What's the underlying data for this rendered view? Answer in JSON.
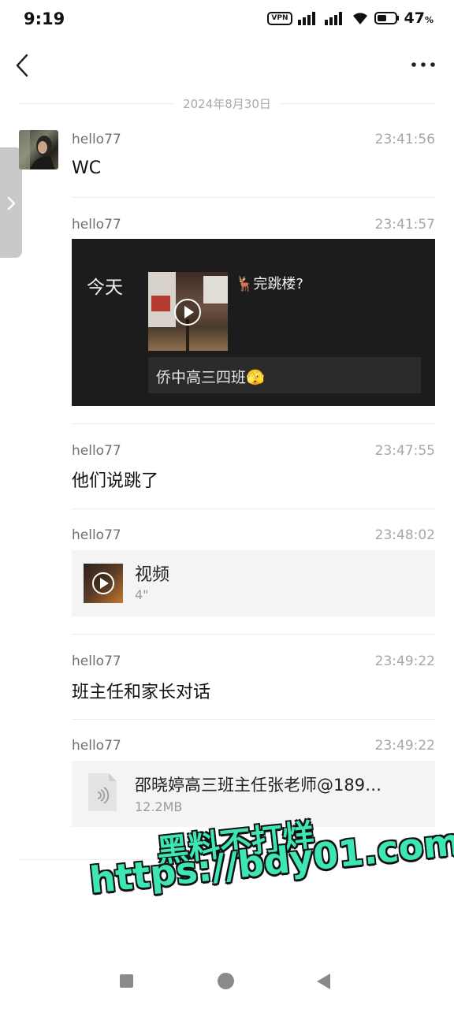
{
  "status_bar": {
    "time": "9:19",
    "vpn_label": "VPN",
    "battery_percent": "47",
    "battery_unit": "%"
  },
  "header": {
    "back_icon": "chevron-left-icon",
    "more_icon": "more-horizontal-icon"
  },
  "date_separator": "2024年8月30日",
  "messages": [
    {
      "sender": "hello77",
      "time": "23:41:56",
      "type": "text",
      "text": "WC"
    },
    {
      "sender": "hello77",
      "time": "23:41:57",
      "type": "shared",
      "card": {
        "heading": "今天",
        "title": "🦌完跳楼?",
        "subtitle": "侨中高三四班🫣"
      }
    },
    {
      "sender": "hello77",
      "time": "23:47:55",
      "type": "text",
      "text": "他们说跳了"
    },
    {
      "sender": "hello77",
      "time": "23:48:02",
      "type": "video",
      "label": "视频",
      "duration": "4\""
    },
    {
      "sender": "hello77",
      "time": "23:49:22",
      "type": "text",
      "text": "班主任和家长对话"
    },
    {
      "sender": "hello77",
      "time": "23:49:22",
      "type": "file",
      "name": "邵晓婷高三班主任张老师@189…",
      "size": "12.2MB"
    }
  ],
  "watermark": {
    "line1": "黑料不打烊",
    "line2": "https://bdy01.com"
  },
  "colors": {
    "watermark": "#3ee6b6",
    "card_bg": "#1c1c1c",
    "bubble_bg": "#f4f4f4"
  }
}
